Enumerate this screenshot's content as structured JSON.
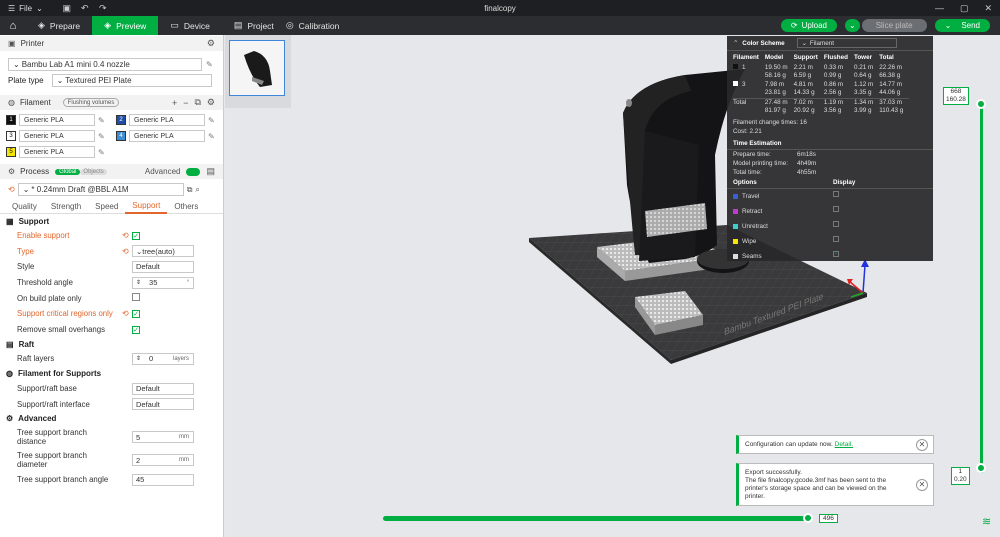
{
  "window": {
    "title": "finalcopy",
    "file_menu": "File"
  },
  "nav": {
    "tabs": [
      {
        "label": "Prepare",
        "icon": "cube-icon"
      },
      {
        "label": "Preview",
        "icon": "preview-icon",
        "active": true
      },
      {
        "label": "Device",
        "icon": "device-icon"
      },
      {
        "label": "Project",
        "icon": "project-icon"
      },
      {
        "label": "Calibration",
        "icon": "calibration-icon"
      }
    ],
    "upload_label": "Upload",
    "slice_label": "Slice plate",
    "send_label": "Send"
  },
  "printer": {
    "section_label": "Printer",
    "printer_name": "Bambu Lab A1 mini 0.4 nozzle",
    "plate_type_label": "Plate type",
    "plate_type_value": "Textured PEI Plate"
  },
  "filament": {
    "section_label": "Filament",
    "flushing_label": "Flushing volumes",
    "items": [
      {
        "index": "1",
        "name": "Generic PLA",
        "color": "#111111",
        "text_color": "#ffffff"
      },
      {
        "index": "2",
        "name": "Generic PLA",
        "color": "#1f4fa8",
        "text_color": "#ffffff"
      },
      {
        "index": "3",
        "name": "Generic PLA",
        "color": "#ffffff",
        "text_color": "#111111"
      },
      {
        "index": "4",
        "name": "Generic PLA",
        "color": "#3d8fd1",
        "text_color": "#ffffff"
      },
      {
        "index": "5",
        "name": "Generic PLA",
        "color": "#f5e600",
        "text_color": "#111111"
      }
    ]
  },
  "process": {
    "section_label": "Process",
    "global_label": "Global",
    "objects_label": "Objects",
    "advanced_label": "Advanced",
    "preset": "* 0.24mm Draft @BBL A1M",
    "tabs": [
      "Quality",
      "Strength",
      "Speed",
      "Support",
      "Others"
    ],
    "active_tab": "Support"
  },
  "support": {
    "group_support": "Support",
    "enable_support": "Enable support",
    "type_label": "Type",
    "type_value": "tree(auto)",
    "style_label": "Style",
    "style_value": "Default",
    "threshold_label": "Threshold angle",
    "threshold_value": "35",
    "on_build_plate_label": "On build plate only",
    "critical_label": "Support critical regions only",
    "remove_small_label": "Remove small overhangs",
    "group_raft": "Raft",
    "raft_layers_label": "Raft layers",
    "raft_layers_value": "0",
    "raft_layers_unit": "layers",
    "group_filament": "Filament for Supports",
    "base_label": "Support/raft base",
    "base_value": "Default",
    "interface_label": "Support/raft interface",
    "interface_value": "Default",
    "group_advanced": "Advanced",
    "branch_distance_label": "Tree support branch distance",
    "branch_distance_value": "5",
    "branch_distance_unit": "mm",
    "branch_diameter_label": "Tree support branch diameter",
    "branch_diameter_value": "2",
    "branch_diameter_unit": "mm",
    "branch_angle_label": "Tree support branch angle",
    "branch_angle_value": "45"
  },
  "stats": {
    "color_scheme_label": "Color Scheme",
    "scheme_value": "Filament",
    "columns": [
      "Filament",
      "Model",
      "Support",
      "Flushed",
      "Tower",
      "Total"
    ],
    "rows": [
      {
        "id": "1",
        "color": "#111111",
        "model": [
          "19.50 m",
          "58.16 g"
        ],
        "support": [
          "2.21 m",
          "6.59 g"
        ],
        "flushed": [
          "0.33 m",
          "0.99 g"
        ],
        "tower": [
          "0.21 m",
          "0.64 g"
        ],
        "total": [
          "22.26 m",
          "66.38 g"
        ]
      },
      {
        "id": "3",
        "color": "#ffffff",
        "model": [
          "7.98 m",
          "23.81 g"
        ],
        "support": [
          "4.81 m",
          "14.33 g"
        ],
        "flushed": [
          "0.86 m",
          "2.56 g"
        ],
        "tower": [
          "1.12 m",
          "3.35 g"
        ],
        "total": [
          "14.77 m",
          "44.06 g"
        ]
      },
      {
        "id": "Total",
        "color": "",
        "model": [
          "27.48 m",
          "81.97 g"
        ],
        "support": [
          "7.02 m",
          "20.92 g"
        ],
        "flushed": [
          "1.19 m",
          "3.56 g"
        ],
        "tower": [
          "1.34 m",
          "3.99 g"
        ],
        "total": [
          "37.03 m",
          "110.43 g"
        ]
      }
    ],
    "filament_change_label": "Filament change times:",
    "filament_change_value": "16",
    "cost_label": "Cost:",
    "cost_value": "2.21",
    "time_estimation_label": "Time Estimation",
    "prepare_label": "Prepare time:",
    "prepare_value": "6m18s",
    "model_print_label": "Model printing time:",
    "model_print_value": "4h49m",
    "total_label": "Total time:",
    "total_value": "4h55m",
    "options_label": "Options",
    "display_label": "Display",
    "options": [
      {
        "name": "Travel",
        "color": "#3a5fd0",
        "checked": false
      },
      {
        "name": "Retract",
        "color": "#c03ad0",
        "checked": false
      },
      {
        "name": "Unretract",
        "color": "#3ad0d0",
        "checked": false
      },
      {
        "name": "Wipe",
        "color": "#f5e600",
        "checked": false
      },
      {
        "name": "Seams",
        "color": "#dddddd",
        "checked": true
      }
    ]
  },
  "layers": {
    "top_value": "668",
    "top_height": "160.28",
    "bottom_value": "1",
    "bottom_height": "0.20",
    "move_value": "496",
    "move_fraction": 0.99
  },
  "plate_label": "Bambu Textured PEI Plate",
  "notifications": {
    "config_text": "Configuration can update now.",
    "config_link": "Detail.",
    "export_text": "Export successfully.",
    "export_detail": "The file finalcopy.gcode.3mf has been sent to the printer's storage space and can be viewed on the printer."
  }
}
